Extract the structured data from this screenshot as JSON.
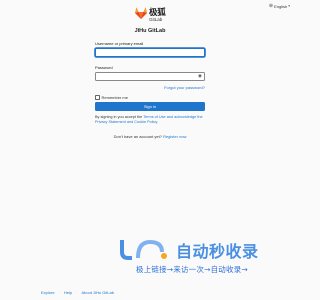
{
  "header": {
    "language": "English",
    "brand_cn": "极狐",
    "brand_en": "GitLab"
  },
  "form": {
    "title": "JiHu GitLab",
    "username_label": "Username or primary email",
    "username_value": "",
    "password_label": "Password",
    "password_value": "",
    "forgot_link": "Forgot your password?",
    "remember_label": "Remember me",
    "remember_checked": false,
    "signin_label": "Sign in",
    "terms_prefix": "By signing in you accept the ",
    "terms_link": "Terms of Use and acknowledge the Privacy Statement and Cookie Policy",
    "terms_suffix": ".",
    "no_account": "Don't have an account yet? ",
    "register_link": "Register now"
  },
  "watermark": {
    "title": "自动秒收录",
    "subtitle": "极上链接→来访一次→自动收录→"
  },
  "footer": {
    "links": [
      "Explore",
      "Help",
      "About JiHu GitLab"
    ]
  },
  "colors": {
    "accent": "#1f75cb",
    "brand_orange": "#e24329"
  }
}
